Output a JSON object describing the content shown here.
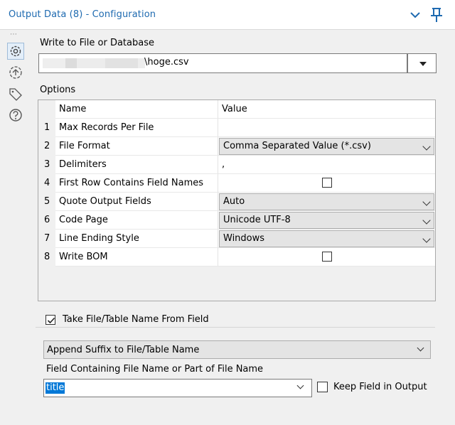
{
  "window": {
    "title": "Output Data (8) - Configuration"
  },
  "rail": {
    "icons": [
      "gear-icon",
      "anchor-icon",
      "tag-icon",
      "help-icon"
    ]
  },
  "output": {
    "label": "Write to File or Database",
    "file_value": "\\hoge.csv"
  },
  "options": {
    "label": "Options",
    "columns": [
      "Name",
      "Value"
    ],
    "rows": [
      {
        "num": "1",
        "name": "Max Records Per File",
        "value": ""
      },
      {
        "num": "2",
        "name": "File Format",
        "value": "Comma Separated Value (*.csv)"
      },
      {
        "num": "3",
        "name": "Delimiters",
        "value": ","
      },
      {
        "num": "4",
        "name": "First Row Contains Field Names",
        "value": ""
      },
      {
        "num": "5",
        "name": "Quote Output Fields",
        "value": "Auto"
      },
      {
        "num": "6",
        "name": "Code Page",
        "value": "Unicode UTF-8"
      },
      {
        "num": "7",
        "name": "Line Ending Style",
        "value": "Windows"
      },
      {
        "num": "8",
        "name": "Write BOM",
        "value": ""
      }
    ]
  },
  "take_name": {
    "label": "Take File/Table Name From Field",
    "checked": true,
    "mode_value": "Append Suffix to File/Table Name",
    "field_label": "Field Containing File Name or Part of File Name",
    "field_value": "title",
    "keep_label": "Keep Field in Output",
    "keep_checked": false
  },
  "colors": {
    "title": "#1e6ab0",
    "selection": "#0078d7"
  }
}
